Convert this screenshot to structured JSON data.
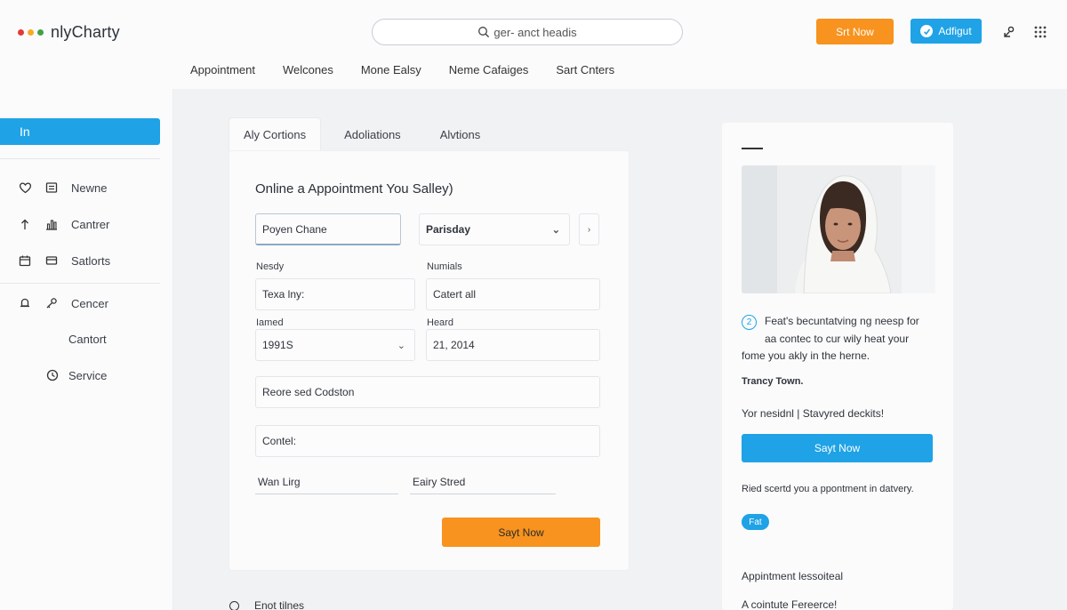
{
  "app": {
    "logo_text": "nlyCharty",
    "logo_dot_colors": [
      "#e53935",
      "#f9a825",
      "#43a047"
    ]
  },
  "colors": {
    "accent_blue": "#1fa2e6",
    "accent_orange": "#f7931e"
  },
  "search": {
    "text": "ger- anct headis",
    "icon": "search-icon"
  },
  "header": {
    "start_button": "Srt Now",
    "admin_button": "Adfigut",
    "icons": [
      "user-link-icon",
      "apps-grid-icon"
    ]
  },
  "nav": {
    "items": [
      "Appointment",
      "Welcones",
      "Mone Ealsy",
      "Neme Cafaiges",
      "Sart Cnters"
    ]
  },
  "sidebar": {
    "active_label": "In",
    "items": [
      {
        "label": "Newne",
        "icon": "heart-icon",
        "icon2": "document-icon"
      },
      {
        "label": "Cantrer",
        "icon": "route-icon",
        "icon2": "bar-chart-icon"
      },
      {
        "label": "Satlorts",
        "icon": "calendar-icon",
        "icon2": "card-icon"
      },
      {
        "label": "Cencer",
        "icon": "bell-icon",
        "icon2": "key-icon"
      },
      {
        "label": "Cantort",
        "icon": ""
      },
      {
        "label": "Service",
        "icon": "clock-icon"
      }
    ]
  },
  "tabs": [
    "Aly Cortions",
    "Adoliations",
    "Alvtions"
  ],
  "form": {
    "title": "Online a Appointment You Salley)",
    "field_name": "Poyen Chane",
    "select_day": "Parisday",
    "label_1": "Nesdy",
    "field_1": "Texa lny:",
    "label_2": "Numials",
    "field_2": "Catert all",
    "label_3": "Iamed",
    "select_3": "1991S",
    "label_4": "Heard",
    "field_4": "21, 2014",
    "field_5": "Reore sed Codston",
    "field_6": "Contel:",
    "underline_1": "Wan Lirg",
    "underline_2": "Eairy Stred",
    "submit": "Sayt Now"
  },
  "footer": {
    "text": "Enot tilnes"
  },
  "right_panel": {
    "badge_number": "2",
    "line_1": "Feat's becuntatving ng neesp for",
    "line_2": "aa contec to cur wily heat your",
    "line_3": "fome you akly in the herne.",
    "name": "Trancy Town.",
    "quote": "Yor nesidnl | Stavyred deckits!",
    "button": "Sayt Now",
    "note": "Ried scertd you a ppontment in datvery.",
    "pill": "Fat",
    "bottom_1": "Appintment lessoiteal",
    "bottom_2": "A cointute Fereerce!"
  }
}
